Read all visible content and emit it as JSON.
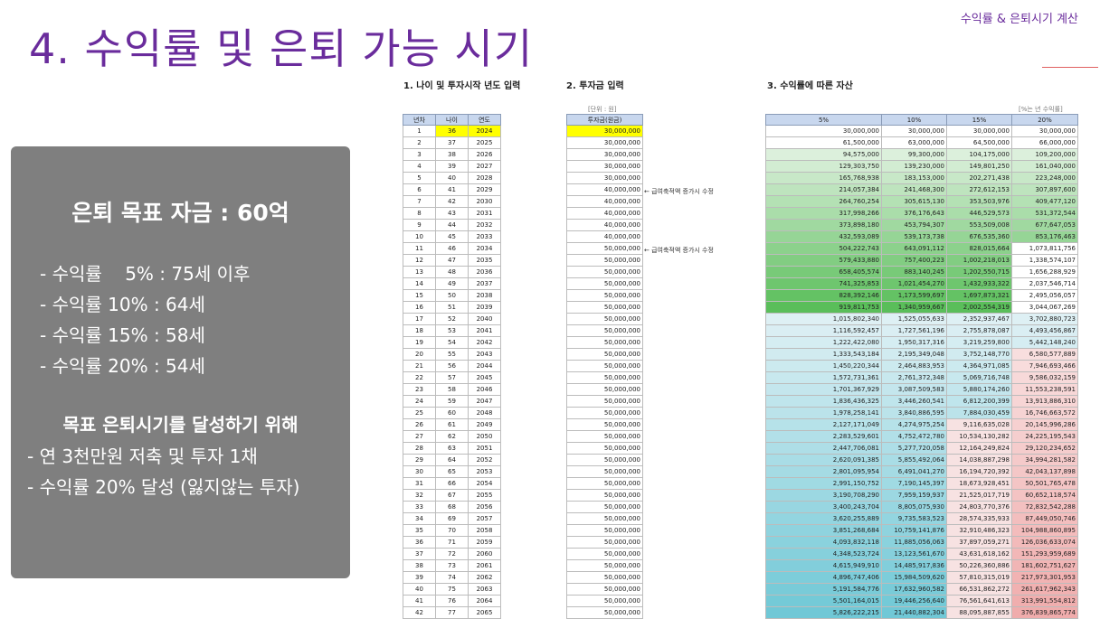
{
  "header": {
    "title": "4. 수익률 및 은퇴 가능 시기",
    "top_right": "수익률 & 은퇴시기 계산"
  },
  "summary": {
    "goal": "은퇴 목표 자금 : 60억",
    "rates": [
      "- 수익률    5% : 75세 이후",
      "- 수익률 10% : 64세",
      "- 수익률 15% : 58세",
      "- 수익률 20% : 54세"
    ],
    "achieve_title": "목표 은퇴시기를 달성하기 위해",
    "achieve_items": [
      "- 연 3천만원 저축 및 투자 1채",
      "- 수익률 20% 달성 (잃지않는 투자)"
    ]
  },
  "sections": {
    "s1": "1. 나이 및 투자시작 년도 입력",
    "s2": "2. 투자금 입력",
    "s3": "3. 수익률에 따른 자산",
    "unit_left": "[단위 : 원]",
    "unit_right": "[%는 년 수익률]"
  },
  "table": {
    "headers_left": [
      "년차",
      "나이",
      "연도"
    ],
    "header_invest": "투자금(원금)",
    "headers_assets": [
      "5%",
      "10%",
      "15%",
      "20%"
    ],
    "notes": [
      "← 급여축적액 증가시 수정",
      "← 급여축적액 증가시 수정"
    ],
    "colors": {
      "highlight": "#ffff00",
      "header": "#c8d7ee"
    },
    "rows": [
      [
        "1",
        "36",
        "2024",
        "30,000,000",
        "30,000,000",
        "30,000,000",
        "30,000,000",
        "30,000,000"
      ],
      [
        "2",
        "37",
        "2025",
        "30,000,000",
        "61,500,000",
        "63,000,000",
        "64,500,000",
        "66,000,000"
      ],
      [
        "3",
        "38",
        "2026",
        "30,000,000",
        "94,575,000",
        "99,300,000",
        "104,175,000",
        "109,200,000"
      ],
      [
        "4",
        "39",
        "2027",
        "30,000,000",
        "129,303,750",
        "139,230,000",
        "149,801,250",
        "161,040,000"
      ],
      [
        "5",
        "40",
        "2028",
        "30,000,000",
        "165,768,938",
        "183,153,000",
        "202,271,438",
        "223,248,000"
      ],
      [
        "6",
        "41",
        "2029",
        "40,000,000",
        "214,057,384",
        "241,468,300",
        "272,612,153",
        "307,897,600"
      ],
      [
        "7",
        "42",
        "2030",
        "40,000,000",
        "264,760,254",
        "305,615,130",
        "353,503,976",
        "409,477,120"
      ],
      [
        "8",
        "43",
        "2031",
        "40,000,000",
        "317,998,266",
        "376,176,643",
        "446,529,573",
        "531,372,544"
      ],
      [
        "9",
        "44",
        "2032",
        "40,000,000",
        "373,898,180",
        "453,794,307",
        "553,509,008",
        "677,647,053"
      ],
      [
        "10",
        "45",
        "2033",
        "40,000,000",
        "432,593,089",
        "539,173,738",
        "676,535,360",
        "853,176,463"
      ],
      [
        "11",
        "46",
        "2034",
        "50,000,000",
        "504,222,743",
        "643,091,112",
        "828,015,664",
        "1,073,811,756"
      ],
      [
        "12",
        "47",
        "2035",
        "50,000,000",
        "579,433,880",
        "757,400,223",
        "1,002,218,013",
        "1,338,574,107"
      ],
      [
        "13",
        "48",
        "2036",
        "50,000,000",
        "658,405,574",
        "883,140,245",
        "1,202,550,715",
        "1,656,288,929"
      ],
      [
        "14",
        "49",
        "2037",
        "50,000,000",
        "741,325,853",
        "1,021,454,270",
        "1,432,933,322",
        "2,037,546,714"
      ],
      [
        "15",
        "50",
        "2038",
        "50,000,000",
        "828,392,146",
        "1,173,599,697",
        "1,697,873,321",
        "2,495,056,057"
      ],
      [
        "16",
        "51",
        "2039",
        "50,000,000",
        "919,811,753",
        "1,340,959,667",
        "2,002,554,319",
        "3,044,067,269"
      ],
      [
        "17",
        "52",
        "2040",
        "50,000,000",
        "1,015,802,340",
        "1,525,055,633",
        "2,352,937,467",
        "3,702,880,723"
      ],
      [
        "18",
        "53",
        "2041",
        "50,000,000",
        "1,116,592,457",
        "1,727,561,196",
        "2,755,878,087",
        "4,493,456,867"
      ],
      [
        "19",
        "54",
        "2042",
        "50,000,000",
        "1,222,422,080",
        "1,950,317,316",
        "3,219,259,800",
        "5,442,148,240"
      ],
      [
        "20",
        "55",
        "2043",
        "50,000,000",
        "1,333,543,184",
        "2,195,349,048",
        "3,752,148,770",
        "6,580,577,889"
      ],
      [
        "21",
        "56",
        "2044",
        "50,000,000",
        "1,450,220,344",
        "2,464,883,953",
        "4,364,971,085",
        "7,946,693,466"
      ],
      [
        "22",
        "57",
        "2045",
        "50,000,000",
        "1,572,731,361",
        "2,761,372,348",
        "5,069,716,748",
        "9,586,032,159"
      ],
      [
        "23",
        "58",
        "2046",
        "50,000,000",
        "1,701,367,929",
        "3,087,509,583",
        "5,880,174,260",
        "11,553,238,591"
      ],
      [
        "24",
        "59",
        "2047",
        "50,000,000",
        "1,836,436,325",
        "3,446,260,541",
        "6,812,200,399",
        "13,913,886,310"
      ],
      [
        "25",
        "60",
        "2048",
        "50,000,000",
        "1,978,258,141",
        "3,840,886,595",
        "7,884,030,459",
        "16,746,663,572"
      ],
      [
        "26",
        "61",
        "2049",
        "50,000,000",
        "2,127,171,049",
        "4,274,975,254",
        "9,116,635,028",
        "20,145,996,286"
      ],
      [
        "27",
        "62",
        "2050",
        "50,000,000",
        "2,283,529,601",
        "4,752,472,780",
        "10,534,130,282",
        "24,225,195,543"
      ],
      [
        "28",
        "63",
        "2051",
        "50,000,000",
        "2,447,706,081",
        "5,277,720,058",
        "12,164,249,824",
        "29,120,234,652"
      ],
      [
        "29",
        "64",
        "2052",
        "50,000,000",
        "2,620,091,385",
        "5,855,492,064",
        "14,038,887,298",
        "34,994,281,582"
      ],
      [
        "30",
        "65",
        "2053",
        "50,000,000",
        "2,801,095,954",
        "6,491,041,270",
        "16,194,720,392",
        "42,043,137,898"
      ],
      [
        "31",
        "66",
        "2054",
        "50,000,000",
        "2,991,150,752",
        "7,190,145,397",
        "18,673,928,451",
        "50,501,765,478"
      ],
      [
        "32",
        "67",
        "2055",
        "50,000,000",
        "3,190,708,290",
        "7,959,159,937",
        "21,525,017,719",
        "60,652,118,574"
      ],
      [
        "33",
        "68",
        "2056",
        "50,000,000",
        "3,400,243,704",
        "8,805,075,930",
        "24,803,770,376",
        "72,832,542,288"
      ],
      [
        "34",
        "69",
        "2057",
        "50,000,000",
        "3,620,255,889",
        "9,735,583,523",
        "28,574,335,933",
        "87,449,050,746"
      ],
      [
        "35",
        "70",
        "2058",
        "50,000,000",
        "3,851,268,684",
        "10,759,141,876",
        "32,910,486,323",
        "104,988,860,895"
      ],
      [
        "36",
        "71",
        "2059",
        "50,000,000",
        "4,093,832,118",
        "11,885,056,063",
        "37,897,059,271",
        "126,036,633,074"
      ],
      [
        "37",
        "72",
        "2060",
        "50,000,000",
        "4,348,523,724",
        "13,123,561,670",
        "43,631,618,162",
        "151,293,959,689"
      ],
      [
        "38",
        "73",
        "2061",
        "50,000,000",
        "4,615,949,910",
        "14,485,917,836",
        "50,226,360,886",
        "181,602,751,627"
      ],
      [
        "39",
        "74",
        "2062",
        "50,000,000",
        "4,896,747,406",
        "15,984,509,620",
        "57,810,315,019",
        "217,973,301,953"
      ],
      [
        "40",
        "75",
        "2063",
        "50,000,000",
        "5,191,584,776",
        "17,632,960,582",
        "66,531,862,272",
        "261,617,962,343"
      ],
      [
        "41",
        "76",
        "2064",
        "50,000,000",
        "5,501,164,015",
        "19,446,256,640",
        "76,561,641,613",
        "313,991,554,812"
      ],
      [
        "42",
        "77",
        "2065",
        "50,000,000",
        "5,826,222,215",
        "21,440,882,304",
        "88,095,887,855",
        "376,839,865,774"
      ]
    ]
  }
}
